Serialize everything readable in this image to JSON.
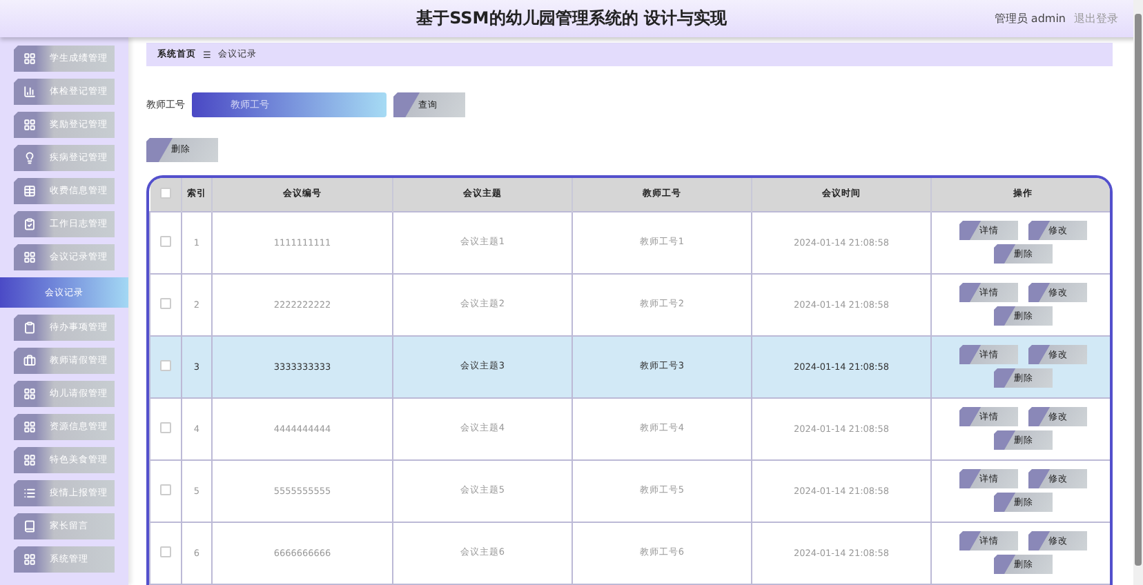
{
  "header": {
    "title": "基于SSM的幼儿园管理系统的 设计与实现",
    "user": "管理员 admin",
    "logout": "退出登录"
  },
  "sidebar": {
    "items": [
      {
        "label": "学生成绩管理",
        "selected": false
      },
      {
        "label": "体检登记管理",
        "selected": false
      },
      {
        "label": "奖励登记管理",
        "selected": false
      },
      {
        "label": "疾病登记管理",
        "selected": false
      },
      {
        "label": "收费信息管理",
        "selected": false
      },
      {
        "label": "工作日志管理",
        "selected": false
      },
      {
        "label": "会议记录管理",
        "selected": false
      },
      {
        "label": "会议记录",
        "selected": true
      },
      {
        "label": "待办事项管理",
        "selected": false
      },
      {
        "label": "教师请假管理",
        "selected": false
      },
      {
        "label": "幼儿请假管理",
        "selected": false
      },
      {
        "label": "资源信息管理",
        "selected": false
      },
      {
        "label": "特色美食管理",
        "selected": false
      },
      {
        "label": "疫情上报管理",
        "selected": false
      },
      {
        "label": "家长留言",
        "selected": false
      },
      {
        "label": "系统管理",
        "selected": false
      }
    ]
  },
  "breadcrumb": [
    "系统首页",
    "会议记录"
  ],
  "breadcrumb_separator": "☰",
  "search": {
    "label": "教师工号",
    "placeholder": "教师工号",
    "button": "查询"
  },
  "delete_button": "删除",
  "table": {
    "all_checked": false,
    "columns": [
      "索引",
      "会议编号",
      "会议主题",
      "教师工号",
      "会议时间",
      "操作"
    ],
    "rows": [
      {
        "index": "1",
        "code": "1111111111",
        "topic": "会议主题1",
        "teacher": "教师工号1",
        "time": "2024-01-14 21:08:58",
        "actions": [
          "详情",
          "修改",
          "删除"
        ],
        "selected": false,
        "checked": false
      },
      {
        "index": "2",
        "code": "2222222222",
        "topic": "会议主题2",
        "teacher": "教师工号2",
        "time": "2024-01-14 21:08:58",
        "actions": [
          "详情",
          "修改",
          "删除"
        ],
        "selected": false,
        "checked": false
      },
      {
        "index": "3",
        "code": "3333333333",
        "topic": "会议主题3",
        "teacher": "教师工号3",
        "time": "2024-01-14 21:08:58",
        "actions": [
          "详情",
          "修改",
          "删除"
        ],
        "selected": true,
        "checked": false
      },
      {
        "index": "4",
        "code": "4444444444",
        "topic": "会议主题4",
        "teacher": "教师工号4",
        "time": "2024-01-14 21:08:58",
        "actions": [
          "详情",
          "修改",
          "删除"
        ],
        "selected": false,
        "checked": false
      },
      {
        "index": "5",
        "code": "5555555555",
        "topic": "会议主题5",
        "teacher": "教师工号5",
        "time": "2024-01-14 21:08:58",
        "actions": [
          "详情",
          "修改",
          "删除"
        ],
        "selected": false,
        "checked": false
      },
      {
        "index": "6",
        "code": "6666666666",
        "topic": "会议主题6",
        "teacher": "教师工号6",
        "time": "2024-01-14 21:08:58",
        "actions": [
          "详情",
          "修改",
          "删除"
        ],
        "selected": false,
        "checked": false
      }
    ]
  }
}
